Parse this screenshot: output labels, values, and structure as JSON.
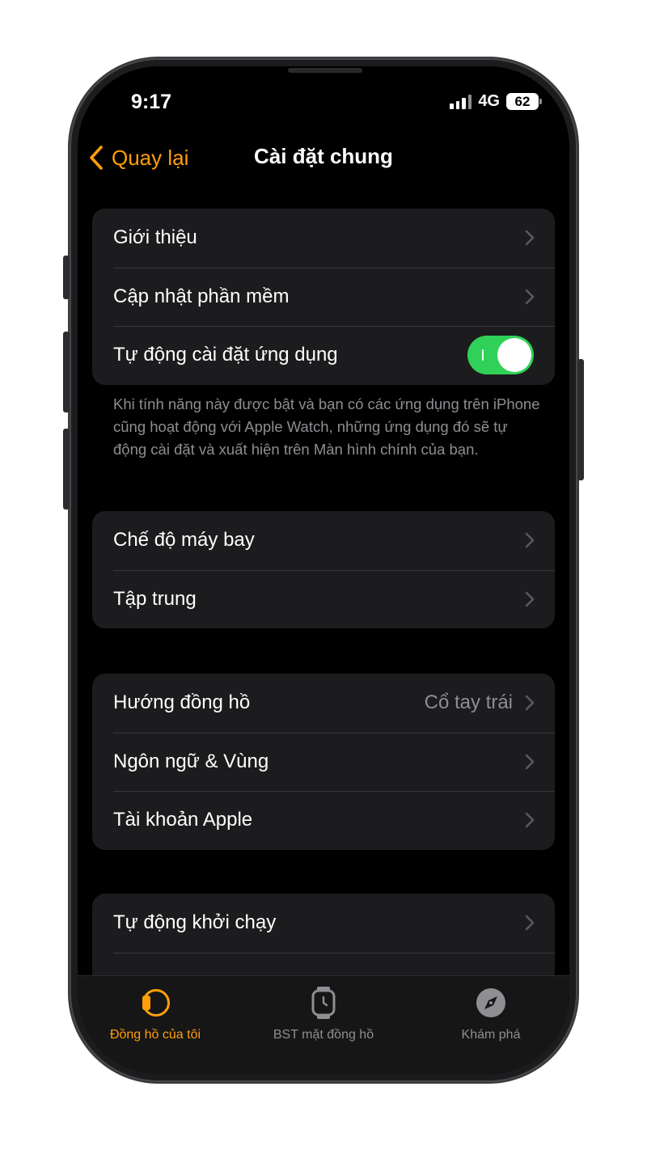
{
  "status_bar": {
    "time": "9:17",
    "network": "4G",
    "battery": "62"
  },
  "nav": {
    "back_label": "Quay lại",
    "title": "Cài đặt chung"
  },
  "group1": {
    "items": [
      {
        "label": "Giới thiệu"
      },
      {
        "label": "Cập nhật phần mềm"
      },
      {
        "label": "Tự động cài đặt ứng dụng",
        "toggle": "on"
      }
    ],
    "footer": "Khi tính năng này được bật và bạn có các ứng dụng trên iPhone cũng hoạt động với Apple Watch, những ứng dụng đó sẽ tự động cài đặt và xuất hiện trên Màn hình chính của bạn."
  },
  "group2": {
    "items": [
      {
        "label": "Chế độ máy bay"
      },
      {
        "label": "Tập trung"
      }
    ]
  },
  "group3": {
    "items": [
      {
        "label": "Hướng đồng hồ",
        "value": "Cổ tay trái"
      },
      {
        "label": "Ngôn ngữ & Vùng"
      },
      {
        "label": "Tài khoản Apple"
      }
    ]
  },
  "group4": {
    "items": [
      {
        "label": "Tự động khởi chạy"
      }
    ]
  },
  "tabbar": {
    "tabs": [
      {
        "label": "Đồng hồ của tôi",
        "icon": "watch-icon",
        "active": true
      },
      {
        "label": "BST mặt đồng hồ",
        "icon": "watch-face-icon",
        "active": false
      },
      {
        "label": "Khám phá",
        "icon": "compass-icon",
        "active": false
      }
    ]
  },
  "colors": {
    "accent": "#ff9f0a",
    "toggle_on": "#30d158",
    "background": "#000000",
    "cell": "#1c1c1e",
    "secondary_text": "#8e8e93"
  }
}
